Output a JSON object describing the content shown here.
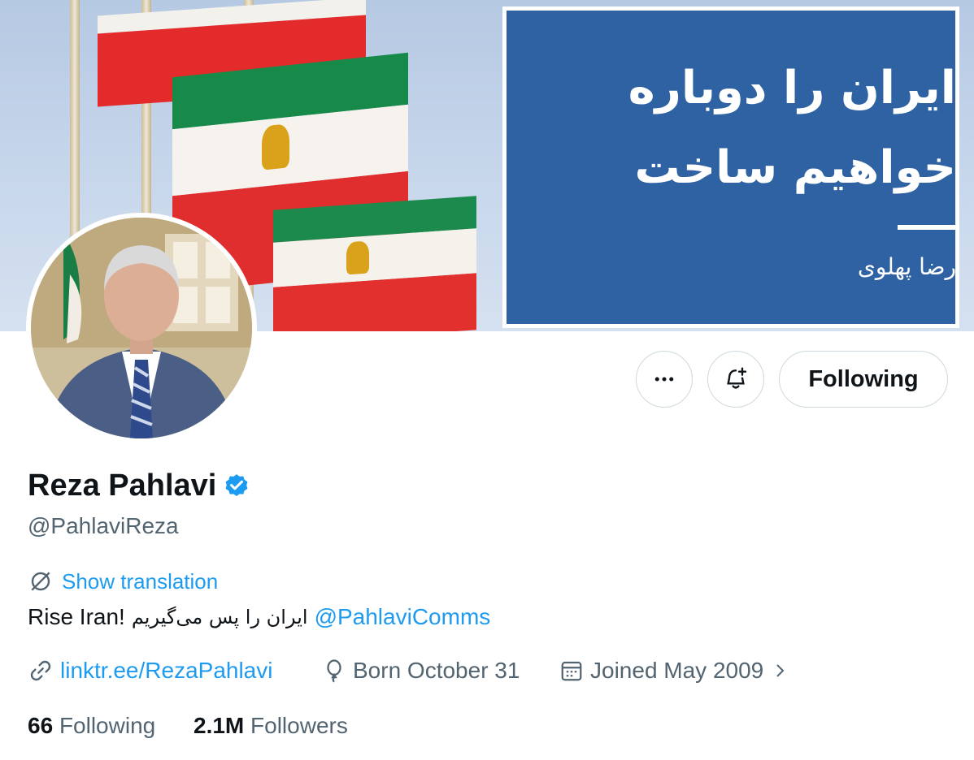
{
  "banner": {
    "title_line1": "ایران را دوباره",
    "title_line2": "خواهیم ساخت",
    "signature": "رضا پهلوی"
  },
  "actions": {
    "more_icon": "more-horizontal-icon",
    "notify_icon": "bell-plus-icon",
    "follow_label": "Following"
  },
  "profile": {
    "display_name": "Reza Pahlavi",
    "verified": true,
    "handle": "@PahlaviReza",
    "show_translation": "Show translation",
    "bio_prefix": "Rise Iran!",
    "bio_farsi": "ایران را پس می‌گیریم",
    "bio_mention": "@PahlaviComms",
    "website": "linktr.ee/RezaPahlavi",
    "birthday": "Born October 31",
    "joined": "Joined May 2009"
  },
  "stats": {
    "following_count": "66",
    "following_label": "Following",
    "followers_count": "2.1M",
    "followers_label": "Followers"
  },
  "colors": {
    "accent": "#1d9bf0",
    "secondary_text": "#536471",
    "banner_panel": "#2f62a3"
  }
}
